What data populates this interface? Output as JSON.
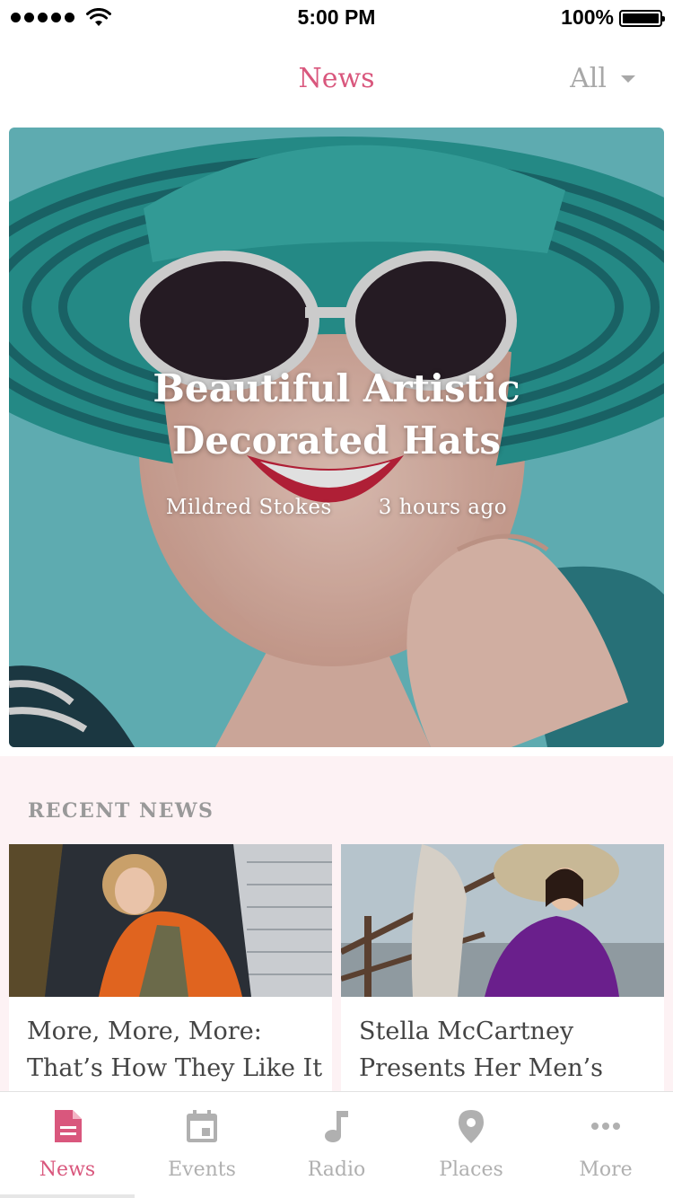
{
  "status_bar": {
    "time": "5:00 PM",
    "battery": "100%"
  },
  "header": {
    "title": "News",
    "filter_label": "All"
  },
  "hero": {
    "headline": "Beautiful Artistic Decorated Hats",
    "author": "Mildred Stokes",
    "time_ago": "3 hours ago"
  },
  "recent": {
    "section_title": "RECENT NEWS",
    "items": [
      {
        "title": "More, More, More: That’s How They Like It"
      },
      {
        "title": "Stella McCartney Presents Her Men’s"
      }
    ]
  },
  "tabbar": {
    "tabs": [
      {
        "label": "News",
        "icon": "document-icon",
        "active": true
      },
      {
        "label": "Events",
        "icon": "calendar-icon",
        "active": false
      },
      {
        "label": "Radio",
        "icon": "music-note-icon",
        "active": false
      },
      {
        "label": "Places",
        "icon": "map-pin-icon",
        "active": false
      },
      {
        "label": "More",
        "icon": "more-dots-icon",
        "active": false
      }
    ]
  },
  "colors": {
    "accent": "#d9577d",
    "inactive": "#b0b0b0",
    "section_bg": "#fdf2f4"
  }
}
